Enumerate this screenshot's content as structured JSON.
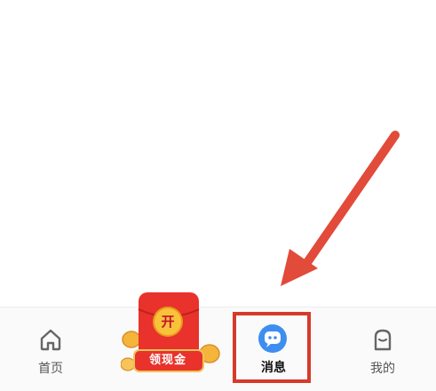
{
  "tabbar": {
    "home": {
      "label": "首页",
      "icon": "home-icon"
    },
    "messages": {
      "label": "消息",
      "icon": "chat-bubble-icon",
      "accent": "#3d8ef0"
    },
    "me": {
      "label": "我的",
      "icon": "smiley-profile-icon"
    }
  },
  "promo": {
    "open_label": "开",
    "button_label": "领现金",
    "icons": [
      "red-envelope-icon",
      "gold-coin-icon"
    ],
    "colors": {
      "envelope": "#e8322b",
      "gold": "#f5b43a"
    }
  },
  "annotation": {
    "arrow_icon": "red-arrow-icon",
    "box_color": "#d63a2a",
    "arrow_color": "#e24a3a"
  }
}
